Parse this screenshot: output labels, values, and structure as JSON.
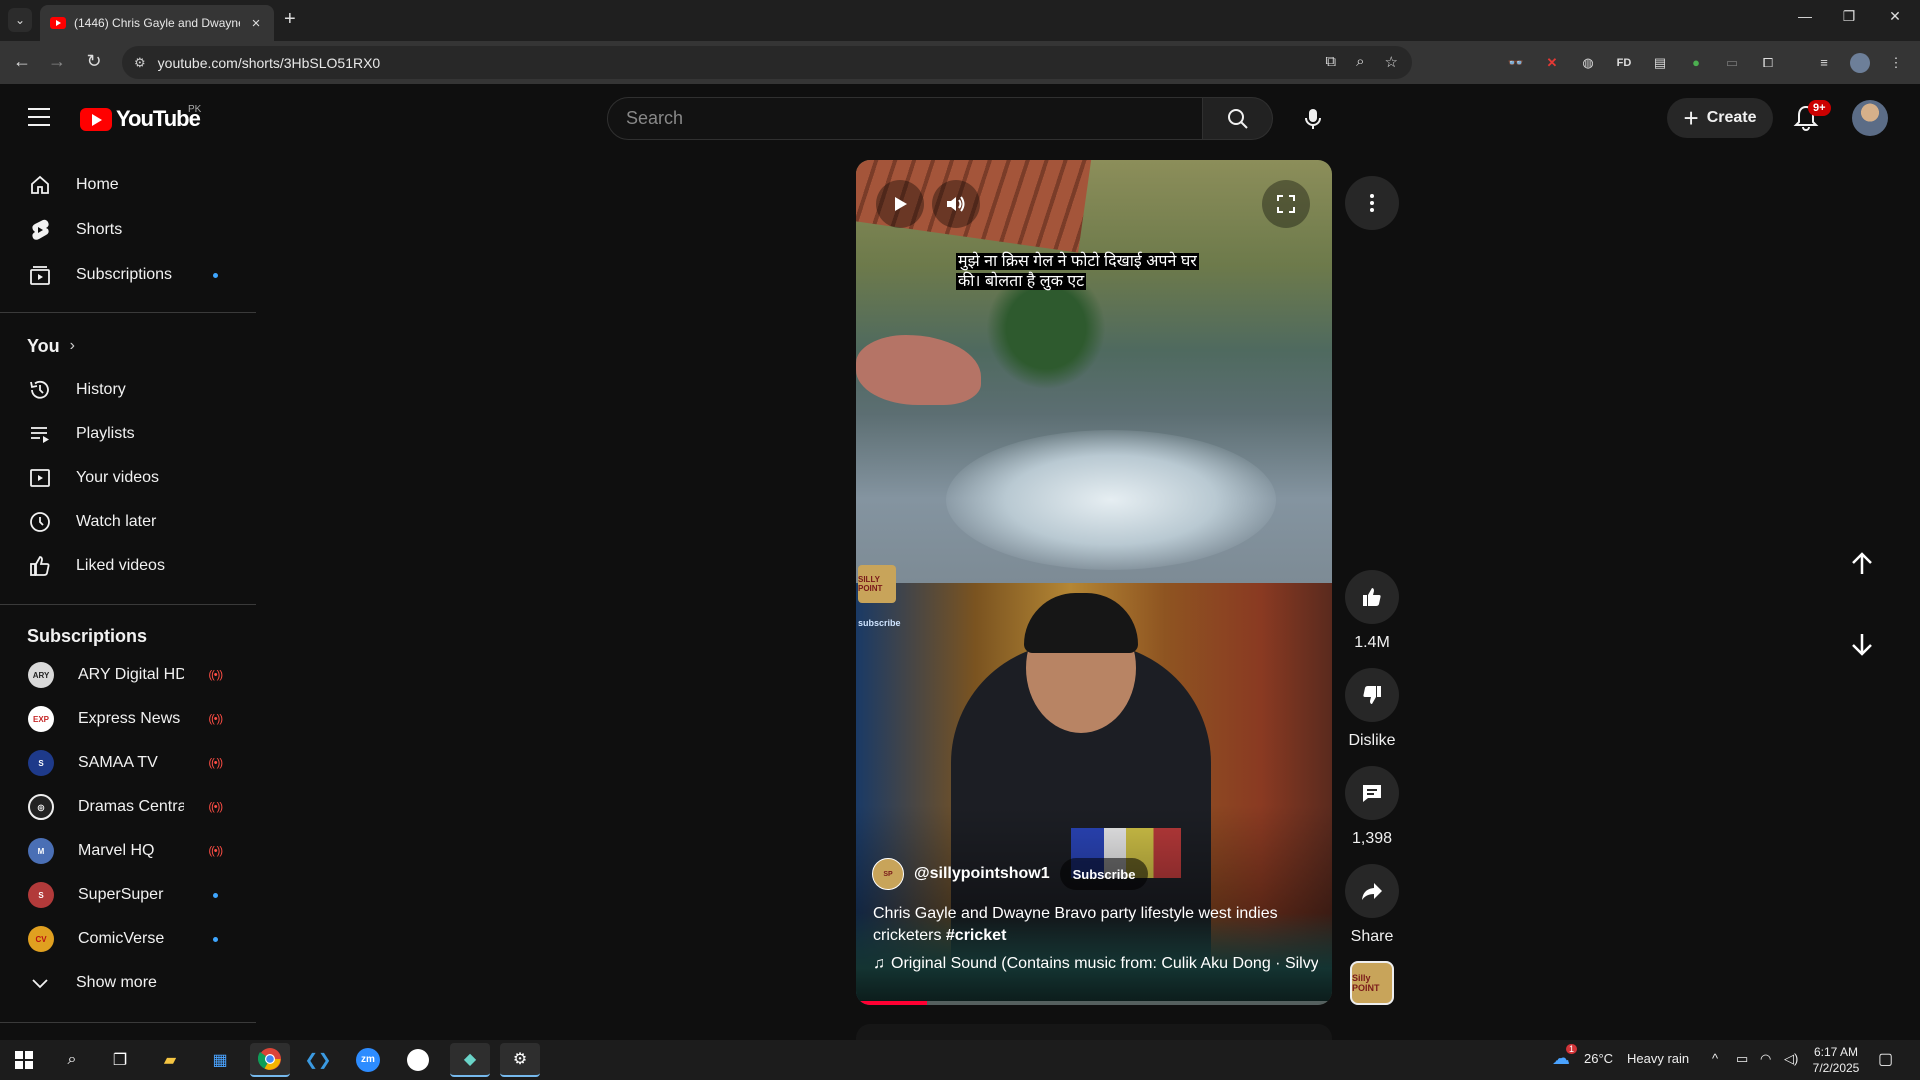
{
  "browser": {
    "tab_title": "(1446) Chris Gayle and Dwayne",
    "url": "youtube.com/shorts/3HbSLO51RX0"
  },
  "header": {
    "logo_text": "YouTube",
    "country": "PK",
    "search_placeholder": "Search",
    "create_label": "Create",
    "notif_count": "9+"
  },
  "sidebar": {
    "main": [
      {
        "label": "Home",
        "icon": "home-icon"
      },
      {
        "label": "Shorts",
        "icon": "shorts-icon"
      },
      {
        "label": "Subscriptions",
        "icon": "subscriptions-icon"
      }
    ],
    "you_heading": "You",
    "you_items": [
      {
        "label": "History",
        "icon": "history-icon"
      },
      {
        "label": "Playlists",
        "icon": "playlists-icon"
      },
      {
        "label": "Your videos",
        "icon": "your-videos-icon"
      },
      {
        "label": "Watch later",
        "icon": "watch-later-icon"
      },
      {
        "label": "Liked videos",
        "icon": "liked-videos-icon"
      }
    ],
    "subs_heading": "Subscriptions",
    "subs": [
      {
        "label": "ARY Digital HD",
        "status": "live",
        "color": "#d9d9d9"
      },
      {
        "label": "Express News",
        "status": "live",
        "color": "#c62828"
      },
      {
        "label": "SAMAA TV",
        "status": "live",
        "color": "#1e3a8a"
      },
      {
        "label": "Dramas Central ...",
        "status": "live",
        "color": "#222222"
      },
      {
        "label": "Marvel HQ",
        "status": "live",
        "color": "#4a6fb5"
      },
      {
        "label": "SuperSuper",
        "status": "new",
        "color": "#b23a3a"
      },
      {
        "label": "ComicVerse",
        "status": "new",
        "color": "#e0a020"
      }
    ],
    "show_more": "Show more",
    "new_dot_color": "#3ea6ff",
    "live_symbol": "((•))"
  },
  "video": {
    "caption_line1": "मुझे ना क्रिस गेल ने फोटो दिखाई अपने घर",
    "caption_line2": "की। बोलता है लुक एट",
    "overlay_channel_logo": "SILLY POINT",
    "overlay_subscribe": "subscribe",
    "channel": "@sillypointshow1",
    "subscribe_label": "Subscribe",
    "desc_text": "Chris Gayle and Dwayne Bravo party lifestyle west indies cricketers ",
    "desc_tag": "#cricket",
    "sound": "Original Sound (Contains music from: Culik Aku Dong · Silvy I",
    "progress": 0.15,
    "progress_color": "#ff0033"
  },
  "actions": {
    "likes": "1.4M",
    "dislike": "Dislike",
    "comments": "1,398",
    "share": "Share",
    "sound_thumb_text": "Silly POINT"
  },
  "taskbar": {
    "weather_temp": "26°C",
    "weather_desc": "Heavy rain",
    "time": "6:17 AM",
    "date": "7/2/2025",
    "weather_badge": "1"
  }
}
